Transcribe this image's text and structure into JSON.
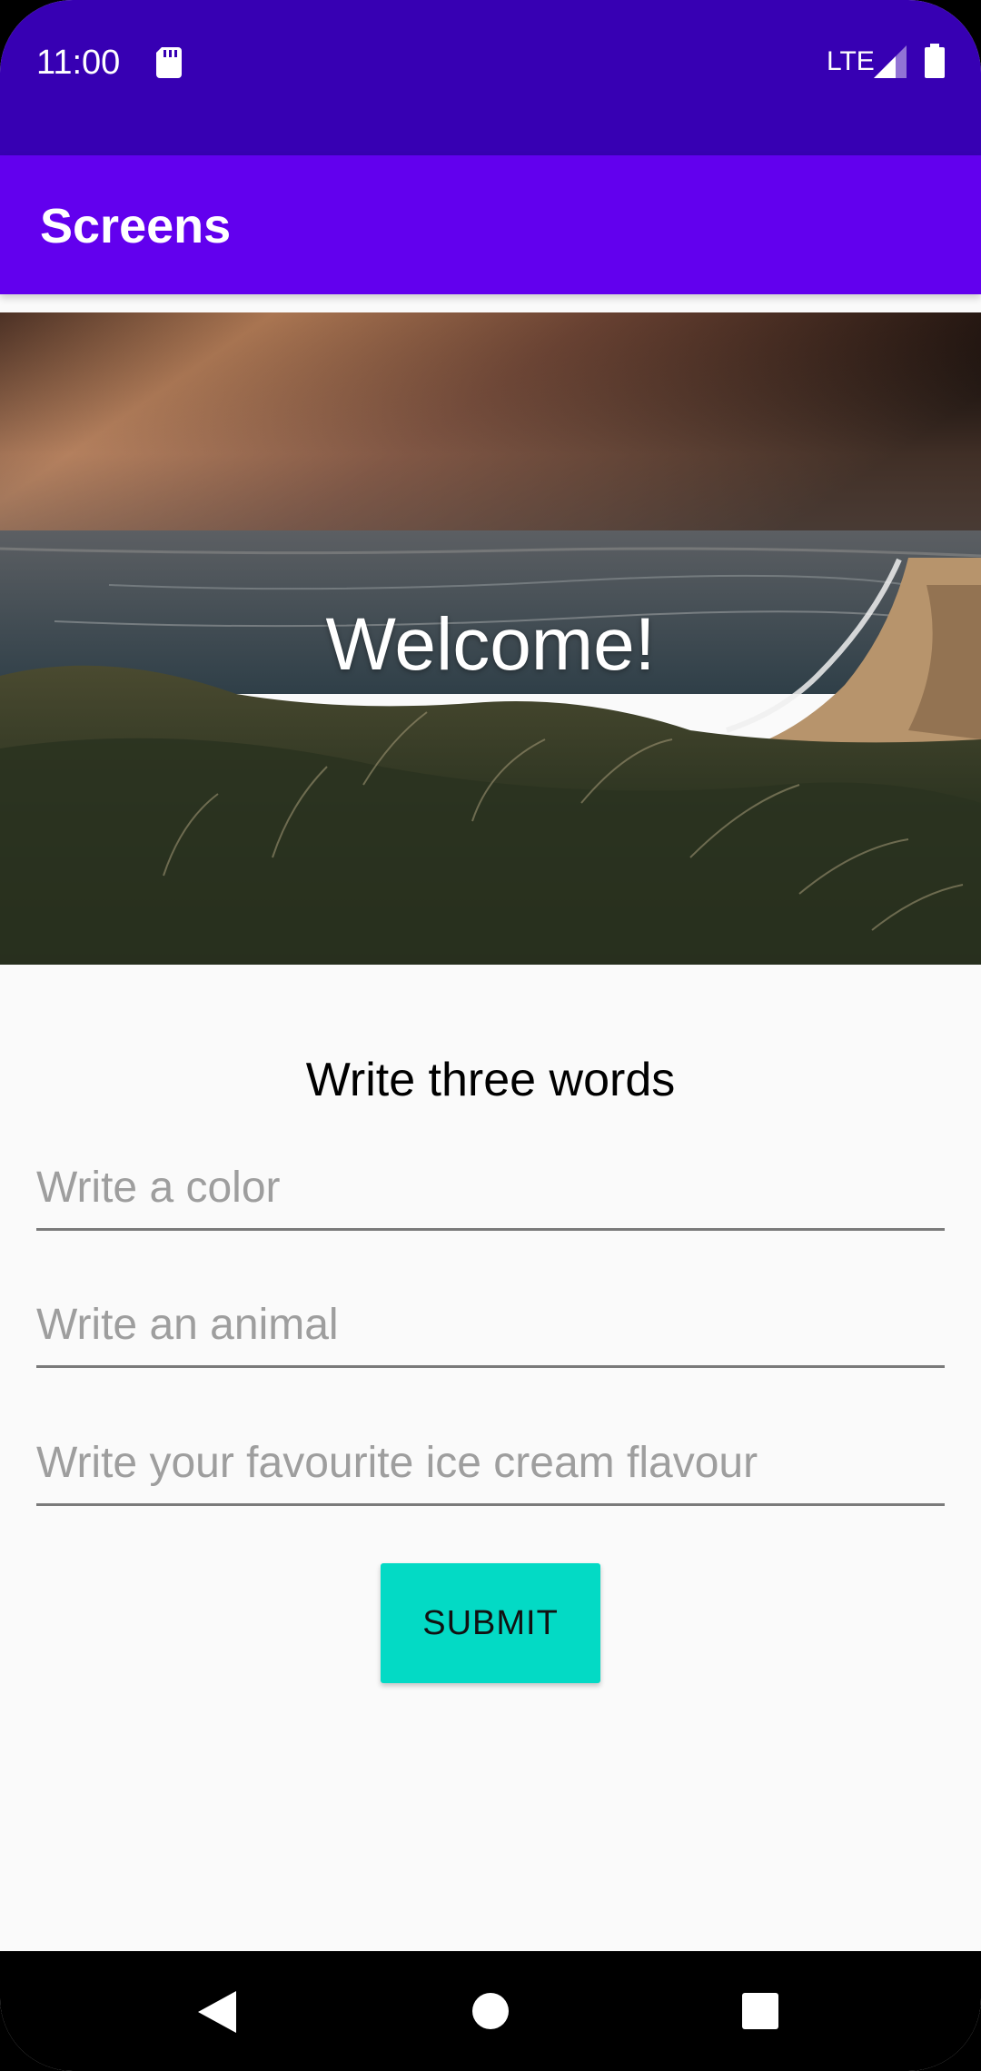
{
  "status_bar": {
    "time": "11:00",
    "network": "LTE",
    "icons": [
      "sd-card-icon",
      "signal-icon",
      "battery-icon"
    ]
  },
  "app_bar": {
    "title": "Screens"
  },
  "hero": {
    "title": "Welcome!"
  },
  "form": {
    "heading": "Write three words",
    "fields": [
      {
        "placeholder": "Write a color",
        "value": ""
      },
      {
        "placeholder": "Write an animal",
        "value": ""
      },
      {
        "placeholder": "Write your favourite ice cream flavour",
        "value": ""
      }
    ],
    "submit_label": "SUBMIT"
  },
  "nav_bar": {
    "icons": [
      "back-icon",
      "home-icon",
      "recents-icon"
    ]
  },
  "colors": {
    "status_bar": "#3700b3",
    "app_bar": "#6200ee",
    "accent": "#03dac5",
    "background": "#fafafa"
  }
}
